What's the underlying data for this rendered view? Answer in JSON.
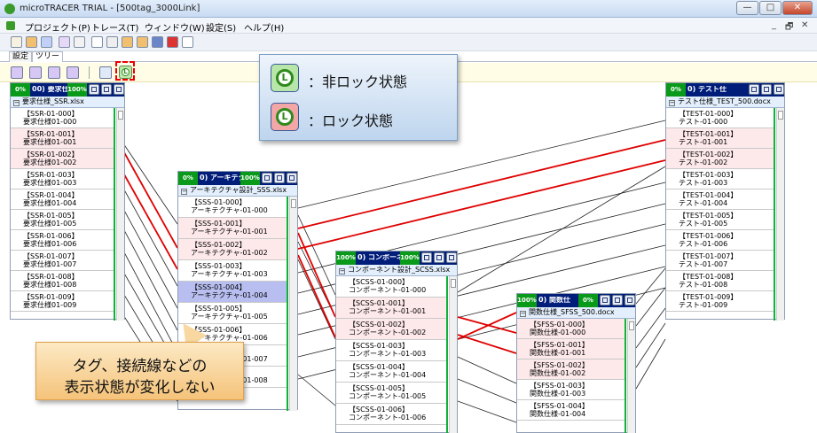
{
  "window": {
    "title": "microTRACER TRIAL - [500tag_3000Link]",
    "min": "—",
    "max": "□",
    "close": "✕"
  },
  "menu": [
    "プロジェクト(P)",
    "トレース(T)",
    "ウィンドウ(W)",
    "設定(S)",
    "ヘルプ(H)"
  ],
  "mdi_controls": [
    "_",
    "🗗",
    "✕"
  ],
  "tabs": [
    "設定",
    "ツリー"
  ],
  "callout": {
    "unlocked_label": "：非ロック状態",
    "locked_label": "：ロック状態",
    "icon_letter": "L"
  },
  "note": {
    "line1": "タグ、接続線などの",
    "line2": "表示状態が変化しない"
  },
  "panels": [
    {
      "id": "ssr",
      "pct": "0%",
      "title": "00) 要求仕",
      "pct2": "100%",
      "file": "要求仕様_SSR.xlsx",
      "rows": [
        {
          "tag": "【SSR-01-000】",
          "name": "要求仕様01-000",
          "state": "normal"
        },
        {
          "tag": "【SSR-01-001】",
          "name": "要求仕様01-001",
          "state": "link"
        },
        {
          "tag": "【SSR-01-002】",
          "name": "要求仕様01-002",
          "state": "link"
        },
        {
          "tag": "【SSR-01-003】",
          "name": "要求仕様01-003",
          "state": "normal"
        },
        {
          "tag": "【SSR-01-004】",
          "name": "要求仕様01-004",
          "state": "normal"
        },
        {
          "tag": "【SSR-01-005】",
          "name": "要求仕様01-005",
          "state": "normal"
        },
        {
          "tag": "【SSR-01-006】",
          "name": "要求仕様01-006",
          "state": "normal"
        },
        {
          "tag": "【SSR-01-007】",
          "name": "要求仕様01-007",
          "state": "normal"
        },
        {
          "tag": "【SSR-01-008】",
          "name": "要求仕様01-008",
          "state": "normal"
        },
        {
          "tag": "【SSR-01-009】",
          "name": "要求仕様01-009",
          "state": "normal"
        }
      ]
    },
    {
      "id": "sss",
      "pct": "0%",
      "title": "0) アーキテクチャ設計",
      "pct2": "100%",
      "file": "アーキテクチャ設計_SSS.xlsx",
      "rows": [
        {
          "tag": "【SSS-01-000】",
          "name": "アーキテクチャ-01-000",
          "state": "normal"
        },
        {
          "tag": "【SSS-01-001】",
          "name": "アーキテクチャ-01-001",
          "state": "link"
        },
        {
          "tag": "【SSS-01-002】",
          "name": "アーキテクチャ-01-002",
          "state": "link"
        },
        {
          "tag": "【SSS-01-003】",
          "name": "アーキテクチャ-01-003",
          "state": "normal"
        },
        {
          "tag": "【SSS-01-004】",
          "name": "アーキテクチャ-01-004",
          "state": "sel"
        },
        {
          "tag": "【SSS-01-005】",
          "name": "アーキテクチャ-01-005",
          "state": "normal"
        },
        {
          "tag": "【SSS-01-006】",
          "name": "アーキテクチャ-01-006",
          "state": "normal"
        },
        {
          "tag": "【SSS-01-007】",
          "name": "アーキテクチャ-01-007",
          "state": "normal"
        },
        {
          "tag": "【SSS-01-008】",
          "name": "アーキテクチャ-01-008",
          "state": "normal"
        }
      ]
    },
    {
      "id": "scss",
      "pct": "100%",
      "title": "0) コンポーネント設計",
      "pct2": "100%",
      "file": "コンポーネント設計_SCSS.xlsx",
      "rows": [
        {
          "tag": "【SCSS-01-000】",
          "name": "コンポーネント-01-000",
          "state": "normal"
        },
        {
          "tag": "【SCSS-01-001】",
          "name": "コンポーネント-01-001",
          "state": "link"
        },
        {
          "tag": "【SCSS-01-002】",
          "name": "コンポーネント-01-002",
          "state": "link"
        },
        {
          "tag": "【SCSS-01-003】",
          "name": "コンポーネント-01-003",
          "state": "normal"
        },
        {
          "tag": "【SCSS-01-004】",
          "name": "コンポーネント-01-004",
          "state": "normal"
        },
        {
          "tag": "【SCSS-01-005】",
          "name": "コンポーネント-01-005",
          "state": "normal"
        },
        {
          "tag": "【SCSS-01-006】",
          "name": "コンポーネント-01-006",
          "state": "normal"
        }
      ]
    },
    {
      "id": "sfss",
      "pct": "100%",
      "title": "0) 関数仕",
      "pct2": "0%",
      "file": "関数仕様_SFSS_500.docx",
      "rows": [
        {
          "tag": "【SFSS-01-000】",
          "name": "関数仕様-01-000",
          "state": "link"
        },
        {
          "tag": "【SFSS-01-001】",
          "name": "関数仕様-01-001",
          "state": "link"
        },
        {
          "tag": "【SFSS-01-002】",
          "name": "関数仕様-01-002",
          "state": "link"
        },
        {
          "tag": "【SFSS-01-003】",
          "name": "関数仕様-01-003",
          "state": "normal"
        },
        {
          "tag": "【SFSS-01-004】",
          "name": "関数仕様-01-004",
          "state": "normal"
        }
      ]
    },
    {
      "id": "test",
      "pct": "0%",
      "title": "0) テスト仕",
      "pct2": "",
      "file": "テスト仕様_TEST_500.docx",
      "rows": [
        {
          "tag": "【TEST-01-000】",
          "name": "テスト-01-000",
          "state": "normal"
        },
        {
          "tag": "【TEST-01-001】",
          "name": "テスト-01-001",
          "state": "link"
        },
        {
          "tag": "【TEST-01-002】",
          "name": "テスト-01-002",
          "state": "link"
        },
        {
          "tag": "【TEST-01-003】",
          "name": "テスト-01-003",
          "state": "normal"
        },
        {
          "tag": "【TEST-01-004】",
          "name": "テスト-01-004",
          "state": "normal"
        },
        {
          "tag": "【TEST-01-005】",
          "name": "テスト-01-005",
          "state": "normal"
        },
        {
          "tag": "【TEST-01-006】",
          "name": "テスト-01-006",
          "state": "normal"
        },
        {
          "tag": "【TEST-01-007】",
          "name": "テスト-01-007",
          "state": "normal"
        },
        {
          "tag": "【TEST-01-008】",
          "name": "テスト-01-008",
          "state": "normal"
        },
        {
          "tag": "【TEST-01-009】",
          "name": "テスト-01-009",
          "state": "normal"
        }
      ]
    }
  ]
}
